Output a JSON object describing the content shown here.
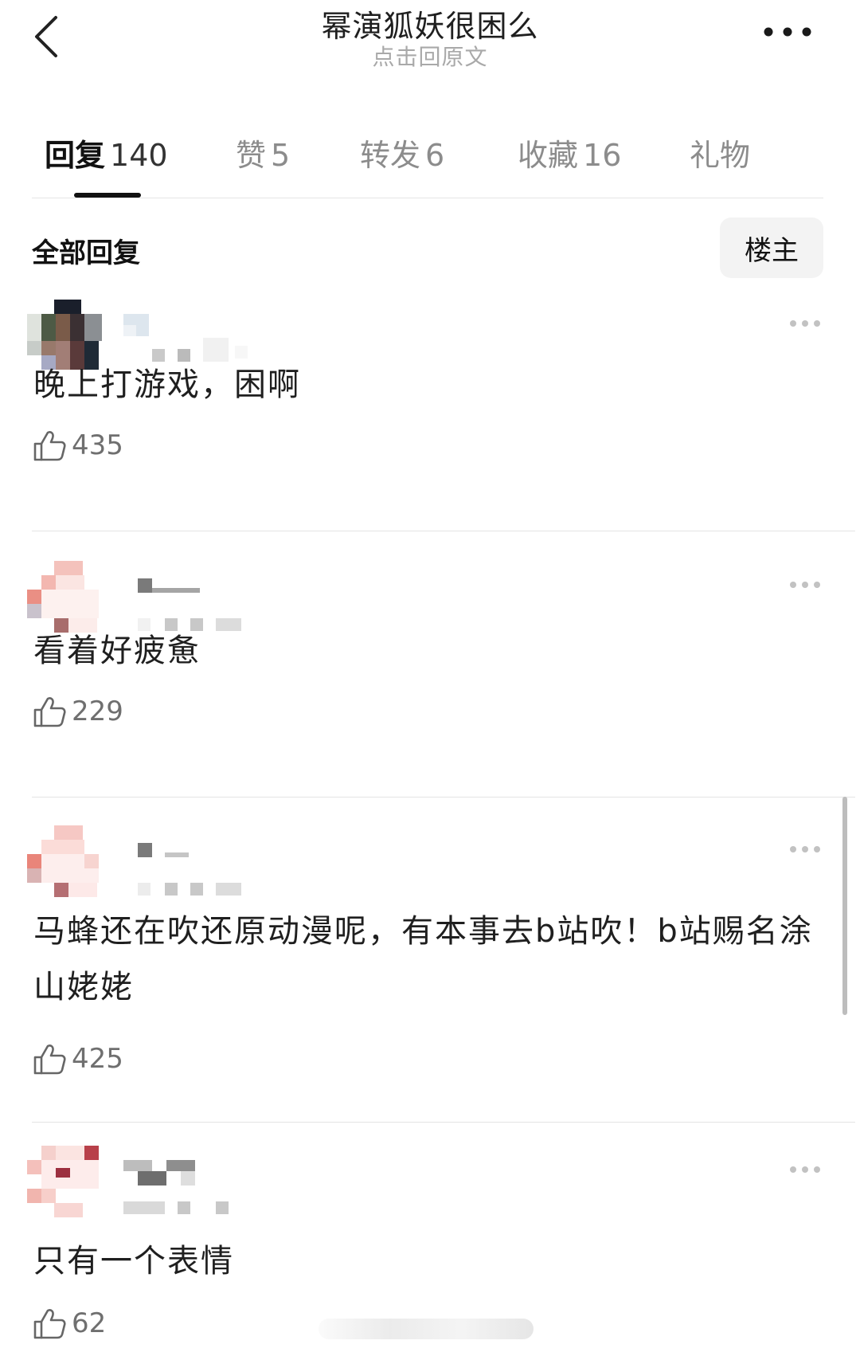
{
  "header": {
    "title": "幂演狐妖很困么",
    "subtitle": "点击回原文"
  },
  "tabs": [
    {
      "label": "回复",
      "count": "140"
    },
    {
      "label": "赞",
      "count": "5"
    },
    {
      "label": "转发",
      "count": "6"
    },
    {
      "label": "收藏",
      "count": "16"
    },
    {
      "label": "礼物",
      "count": ""
    }
  ],
  "section": {
    "title": "全部回复",
    "owner_button": "楼主"
  },
  "comments": [
    {
      "text": "晚上打游戏，困啊",
      "likes": "435"
    },
    {
      "text": "看着好疲惫",
      "likes": "229"
    },
    {
      "text": "马蜂还在吹还原动漫呢，有本事去b站吹！b站赐名涂山姥姥",
      "likes": "425"
    },
    {
      "text": "只有一个表情",
      "likes": "62"
    }
  ],
  "icons": {
    "back": "chevron-left-icon",
    "more": "more-horizontal-icon",
    "like": "thumbs-up-icon"
  }
}
